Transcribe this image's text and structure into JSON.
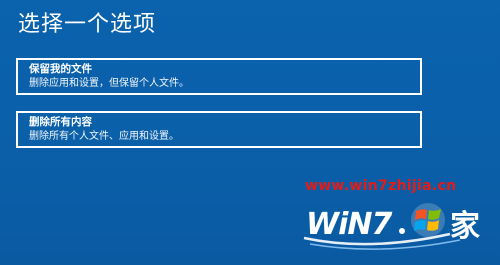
{
  "screen": {
    "title": "选择一个选项"
  },
  "options": [
    {
      "title": "保留我的文件",
      "description": "删除应用和设置，但保留个人文件。"
    },
    {
      "title": "删除所有内容",
      "description": "删除所有个人文件、应用和设置。"
    }
  ],
  "watermark": {
    "url": "www.win7zhijia.cn",
    "logo_text_left": "WiN7",
    "logo_text_right": "家",
    "url_color": "#e41b17"
  },
  "colors": {
    "background": "#0a5fa8",
    "text": "#ffffff"
  }
}
